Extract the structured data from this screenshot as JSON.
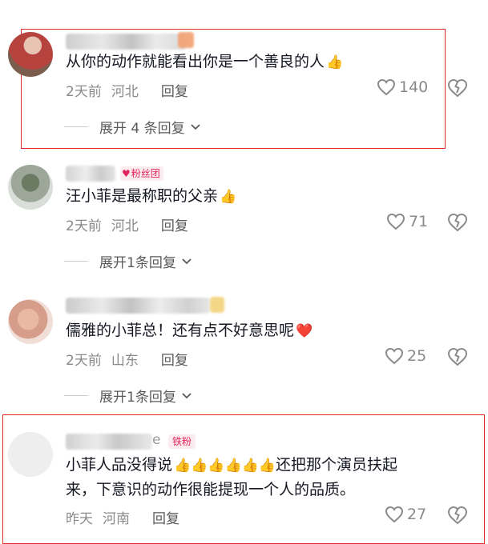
{
  "comments": [
    {
      "text": "从你的动作就能看出你是一个善良的人",
      "emoji": "👍",
      "time": "2天前",
      "location": "河北",
      "reply_label": "回复",
      "likes": "140",
      "expand_label": "展开 4 条回复",
      "badge": ""
    },
    {
      "text": "汪小菲是最称职的父亲",
      "emoji": "👍",
      "time": "2天前",
      "location": "河北",
      "reply_label": "回复",
      "likes": "71",
      "expand_label": "展开1条回复",
      "badge": "粉丝团"
    },
    {
      "text": "儒雅的小菲总！还有点不好意思呢",
      "emoji": "❤️",
      "time": "2天前",
      "location": "山东",
      "reply_label": "回复",
      "likes": "25",
      "expand_label": "展开1条回复",
      "badge": ""
    },
    {
      "text_line1": "小菲人品没得说",
      "emoji_run": "👍👍👍👍👍👍",
      "text_line1_end": "还把那个演员扶起",
      "text_line2": "来，下意识的动作很能提现一个人的品质。",
      "time": "昨天",
      "location": "河南",
      "reply_label": "回复",
      "likes": "27",
      "badge": "铁粉",
      "name_suffix": "e"
    }
  ],
  "colors": {
    "highlight_border": "#e02b2b",
    "badge_text": "#e0245e",
    "meta_text": "#8a8a8a"
  },
  "icons": [
    "like-heart-icon",
    "dislike-broken-heart-icon",
    "chevron-down-icon",
    "fan-club-heart-icon"
  ]
}
